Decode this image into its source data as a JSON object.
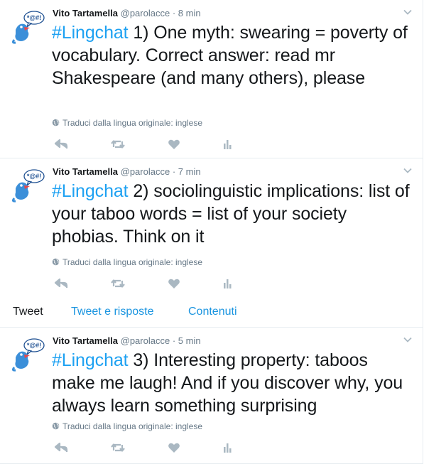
{
  "tweets": [
    {
      "name": "Vito Tartamella",
      "handle": "@parolacce",
      "separator": "·",
      "time": "8 min",
      "hashtag": "#Lingchat",
      "text_rest": " 1) One myth: swearing = poverty of vocabulary. Correct answer: read mr Shakespeare (and many others), please",
      "translate": "Traduci dalla lingua originale: inglese",
      "avatar_badge": "*@#!"
    },
    {
      "name": "Vito Tartamella",
      "handle": "@parolacce",
      "separator": "·",
      "time": "7 min",
      "hashtag": "#Lingchat",
      "text_rest": " 2) sociolinguistic implications: list of your taboo words = list of your society phobias. Think on it",
      "translate": "Traduci dalla lingua originale: inglese",
      "avatar_badge": "*@#!"
    },
    {
      "name": "Vito Tartamella",
      "handle": "@parolacce",
      "separator": "·",
      "time": "5 min",
      "hashtag": "#Lingchat",
      "text_rest": " 3) Interesting property: taboos make me laugh! And if you discover why, you always learn something surprising",
      "translate": "Traduci dalla lingua originale: inglese",
      "avatar_badge": "*@#!"
    }
  ],
  "tabs": {
    "tweet": "Tweet",
    "replies": "Tweet e risposte",
    "media": "Contenuti"
  },
  "colors": {
    "accent": "#1da1f2",
    "link": "#1b95e0",
    "muted": "#657786",
    "icon": "#aab8c2",
    "avatar_bird": "#3b8fd9"
  },
  "icons": [
    "reply-icon",
    "retweet-icon",
    "like-icon",
    "analytics-icon",
    "globe-icon",
    "chevron-down-icon"
  ]
}
